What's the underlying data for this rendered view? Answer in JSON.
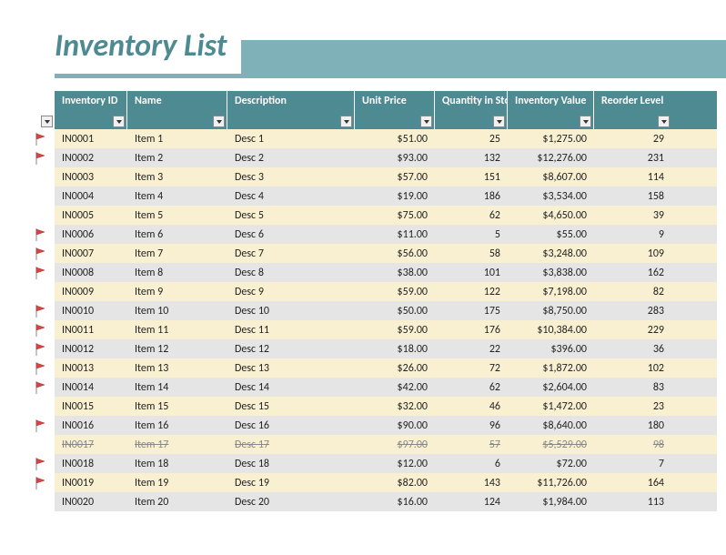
{
  "title": "Inventory List",
  "columns": {
    "id": "Inventory ID",
    "name": "Name",
    "desc": "Description",
    "price": "Unit Price",
    "qty": "Quantity in Stock",
    "value": "Inventory Value",
    "reorder": "Reorder Level"
  },
  "rows": [
    {
      "flag": true,
      "id": "IN0001",
      "name": "Item 1",
      "desc": "Desc 1",
      "price": "$51.00",
      "qty": "25",
      "value": "$1,275.00",
      "reorder": "29",
      "strike": false
    },
    {
      "flag": true,
      "id": "IN0002",
      "name": "Item 2",
      "desc": "Desc 2",
      "price": "$93.00",
      "qty": "132",
      "value": "$12,276.00",
      "reorder": "231",
      "strike": false
    },
    {
      "flag": false,
      "id": "IN0003",
      "name": "Item 3",
      "desc": "Desc 3",
      "price": "$57.00",
      "qty": "151",
      "value": "$8,607.00",
      "reorder": "114",
      "strike": false
    },
    {
      "flag": false,
      "id": "IN0004",
      "name": "Item 4",
      "desc": "Desc 4",
      "price": "$19.00",
      "qty": "186",
      "value": "$3,534.00",
      "reorder": "158",
      "strike": false
    },
    {
      "flag": false,
      "id": "IN0005",
      "name": "Item 5",
      "desc": "Desc 5",
      "price": "$75.00",
      "qty": "62",
      "value": "$4,650.00",
      "reorder": "39",
      "strike": false
    },
    {
      "flag": true,
      "id": "IN0006",
      "name": "Item 6",
      "desc": "Desc 6",
      "price": "$11.00",
      "qty": "5",
      "value": "$55.00",
      "reorder": "9",
      "strike": false
    },
    {
      "flag": true,
      "id": "IN0007",
      "name": "Item 7",
      "desc": "Desc 7",
      "price": "$56.00",
      "qty": "58",
      "value": "$3,248.00",
      "reorder": "109",
      "strike": false
    },
    {
      "flag": true,
      "id": "IN0008",
      "name": "Item 8",
      "desc": "Desc 8",
      "price": "$38.00",
      "qty": "101",
      "value": "$3,838.00",
      "reorder": "162",
      "strike": false
    },
    {
      "flag": false,
      "id": "IN0009",
      "name": "Item 9",
      "desc": "Desc 9",
      "price": "$59.00",
      "qty": "122",
      "value": "$7,198.00",
      "reorder": "82",
      "strike": false
    },
    {
      "flag": true,
      "id": "IN0010",
      "name": "Item 10",
      "desc": "Desc 10",
      "price": "$50.00",
      "qty": "175",
      "value": "$8,750.00",
      "reorder": "283",
      "strike": false
    },
    {
      "flag": true,
      "id": "IN0011",
      "name": "Item 11",
      "desc": "Desc 11",
      "price": "$59.00",
      "qty": "176",
      "value": "$10,384.00",
      "reorder": "229",
      "strike": false
    },
    {
      "flag": true,
      "id": "IN0012",
      "name": "Item 12",
      "desc": "Desc 12",
      "price": "$18.00",
      "qty": "22",
      "value": "$396.00",
      "reorder": "36",
      "strike": false
    },
    {
      "flag": true,
      "id": "IN0013",
      "name": "Item 13",
      "desc": "Desc 13",
      "price": "$26.00",
      "qty": "72",
      "value": "$1,872.00",
      "reorder": "102",
      "strike": false
    },
    {
      "flag": true,
      "id": "IN0014",
      "name": "Item 14",
      "desc": "Desc 14",
      "price": "$42.00",
      "qty": "62",
      "value": "$2,604.00",
      "reorder": "83",
      "strike": false
    },
    {
      "flag": false,
      "id": "IN0015",
      "name": "Item 15",
      "desc": "Desc 15",
      "price": "$32.00",
      "qty": "46",
      "value": "$1,472.00",
      "reorder": "23",
      "strike": false
    },
    {
      "flag": true,
      "id": "IN0016",
      "name": "Item 16",
      "desc": "Desc 16",
      "price": "$90.00",
      "qty": "96",
      "value": "$8,640.00",
      "reorder": "180",
      "strike": false
    },
    {
      "flag": false,
      "id": "IN0017",
      "name": "Item 17",
      "desc": "Desc 17",
      "price": "$97.00",
      "qty": "57",
      "value": "$5,529.00",
      "reorder": "98",
      "strike": true
    },
    {
      "flag": true,
      "id": "IN0018",
      "name": "Item 18",
      "desc": "Desc 18",
      "price": "$12.00",
      "qty": "6",
      "value": "$72.00",
      "reorder": "7",
      "strike": false
    },
    {
      "flag": true,
      "id": "IN0019",
      "name": "Item 19",
      "desc": "Desc 19",
      "price": "$82.00",
      "qty": "143",
      "value": "$11,726.00",
      "reorder": "164",
      "strike": false
    },
    {
      "flag": false,
      "id": "IN0020",
      "name": "Item 20",
      "desc": "Desc 20",
      "price": "$16.00",
      "qty": "124",
      "value": "$1,984.00",
      "reorder": "113",
      "strike": false
    }
  ]
}
